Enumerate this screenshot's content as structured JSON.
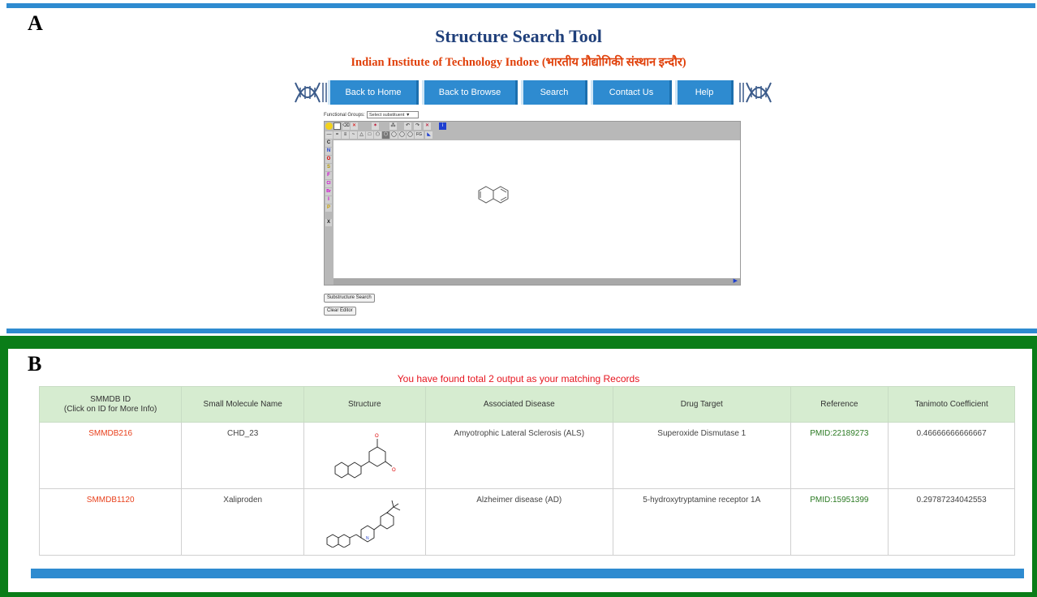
{
  "panels": {
    "a_label": "A",
    "b_label": "B"
  },
  "header": {
    "title": "Structure Search Tool",
    "subtitle": "Indian Institute of Technology Indore (भारतीय प्रौद्योगिकी संस्थान इन्दौर)"
  },
  "nav": {
    "items": [
      "Back to Home",
      "Back to Browse",
      "Search",
      "Contact Us",
      "Help"
    ]
  },
  "editor": {
    "functional_groups_label": "Functional Groups:",
    "functional_groups_select": "Select substituent  ▼",
    "atom_buttons": [
      "C",
      "N",
      "O",
      "S",
      "F",
      "Cl",
      "Br",
      "I",
      "P",
      "X"
    ],
    "toolbar_text": [
      "FG"
    ],
    "substructure_search_label": "Substructure Search",
    "clear_editor_label": "Clear Editor"
  },
  "results": {
    "found_text": "You have found total 2 output as your matching Records",
    "headers": {
      "id_line1": "SMMDB ID",
      "id_line2": "(Click on ID for More Info)",
      "name": "Small Molecule Name",
      "structure": "Structure",
      "disease": "Associated Disease",
      "target": "Drug Target",
      "reference": "Reference",
      "tanimoto": "Tanimoto Coefficient"
    },
    "rows": [
      {
        "id": "SMMDB216",
        "name": "CHD_23",
        "disease": "Amyotrophic Lateral Sclerosis (ALS)",
        "target": "Superoxide Dismutase 1",
        "reference": "PMID:22189273",
        "tanimoto": "0.46666666666667"
      },
      {
        "id": "SMMDB1120",
        "name": "Xaliproden",
        "disease": "Alzheimer disease (AD)",
        "target": "5-hydroxytryptamine receptor 1A",
        "reference": "PMID:15951399",
        "tanimoto": "0.29787234042553"
      }
    ]
  },
  "colors": {
    "nav_blue": "#2e8bd0",
    "panel_green": "#0a7d18",
    "subtitle_red": "#e0400a",
    "title_blue": "#1f3f7a",
    "link_orange": "#e8401c",
    "pmid_green": "#2a7a22"
  }
}
